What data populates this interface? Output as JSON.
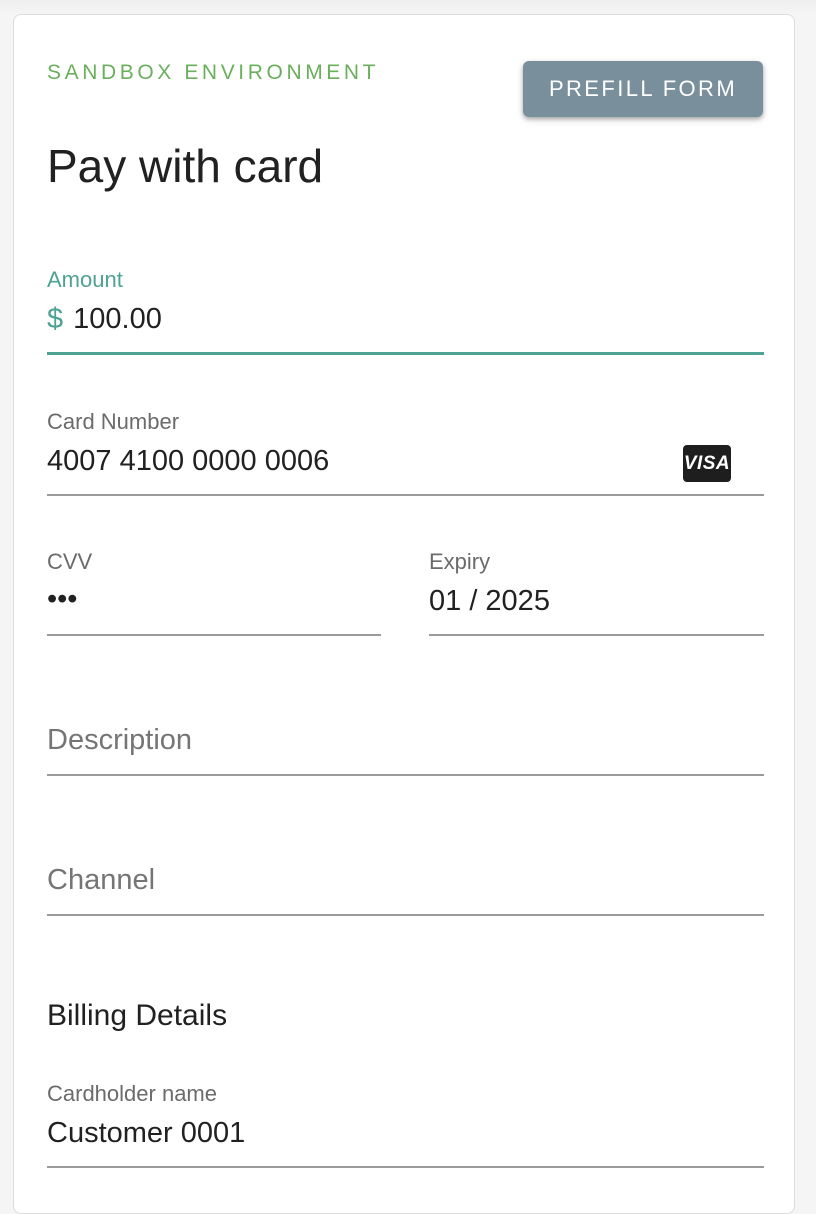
{
  "env_label": "SANDBOX ENVIRONMENT",
  "prefill_button": "PREFILL FORM",
  "title": "Pay with card",
  "amount": {
    "label": "Amount",
    "currency": "$",
    "value": "100.00"
  },
  "card_number": {
    "label": "Card Number",
    "value": "4007 4100 0000 0006",
    "brand_icon": "visa-icon",
    "brand_text": "VISA"
  },
  "cvv": {
    "label": "CVV",
    "value": "•••"
  },
  "expiry": {
    "label": "Expiry",
    "value": "01 / 2025"
  },
  "description": {
    "placeholder": "Description"
  },
  "channel": {
    "placeholder": "Channel"
  },
  "billing": {
    "heading": "Billing Details",
    "cardholder_label": "Cardholder name",
    "cardholder_value": "Customer 0001"
  },
  "colors": {
    "accent": "#4ea293",
    "env_green": "#6aaf5c",
    "button_bg": "#7a8f9c"
  }
}
